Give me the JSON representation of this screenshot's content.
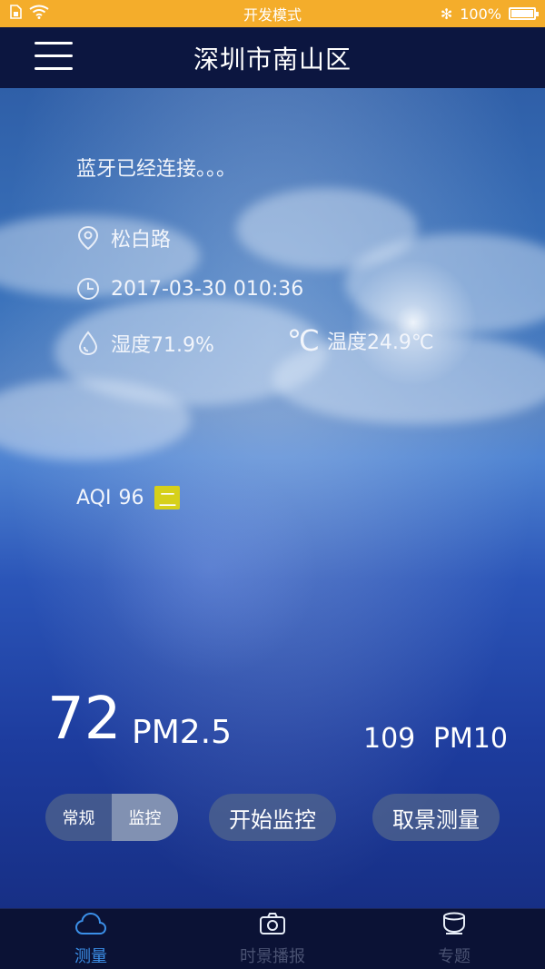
{
  "status_bar": {
    "center_text": "开发模式",
    "battery_text": "100%",
    "battery_level": 1.0,
    "bluetooth_glyph": "✻"
  },
  "header": {
    "title": "深圳市南山区"
  },
  "weather": {
    "bluetooth_status": "蓝牙已经连接。。。",
    "location": "松白路",
    "datetime": "2017-03-30 010:36",
    "humidity": "湿度71.9%",
    "temperature_unit": "℃",
    "temperature": "温度24.9℃"
  },
  "aqi": {
    "label": "AQI",
    "value": "96",
    "badge": "二",
    "badge_color": "#d6d01a"
  },
  "readings": {
    "pm25_value": "72",
    "pm25_label": "PM2.5",
    "pm10_value": "109",
    "pm10_label": "PM10"
  },
  "controls": {
    "segment": [
      "常规",
      "监控"
    ],
    "segment_selected": "监控",
    "start_monitor": "开始监控",
    "capture_measure": "取景测量"
  },
  "tabs": [
    {
      "label": "测量",
      "icon": "cloud-icon",
      "active": true
    },
    {
      "label": "时景播报",
      "icon": "camera-icon",
      "active": false
    },
    {
      "label": "专题",
      "icon": "cup-icon",
      "active": false
    }
  ],
  "colors": {
    "status_bar": "#f4ad2b",
    "header_bg": "#0c1640",
    "tab_active": "#3b8fe8",
    "tab_inactive": "#4a5272"
  }
}
